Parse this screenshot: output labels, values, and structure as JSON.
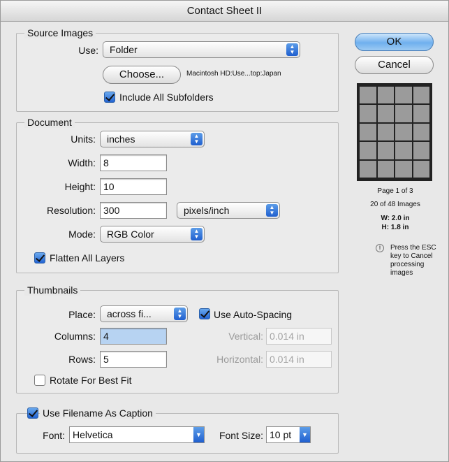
{
  "window": {
    "title": "Contact Sheet II"
  },
  "buttons": {
    "ok": "OK",
    "cancel": "Cancel"
  },
  "source": {
    "title": "Source Images",
    "use_label": "Use:",
    "use_value": "Folder",
    "choose_label": "Choose...",
    "path": "Macintosh HD:Use...top:Japan",
    "include_subfolders_label": "Include All Subfolders",
    "include_subfolders_checked": true
  },
  "document": {
    "title": "Document",
    "units_label": "Units:",
    "units_value": "inches",
    "width_label": "Width:",
    "width_value": "8",
    "height_label": "Height:",
    "height_value": "10",
    "resolution_label": "Resolution:",
    "resolution_value": "300",
    "resolution_units": "pixels/inch",
    "mode_label": "Mode:",
    "mode_value": "RGB Color",
    "flatten_label": "Flatten All Layers",
    "flatten_checked": true
  },
  "thumbnails": {
    "title": "Thumbnails",
    "place_label": "Place:",
    "place_value": "across fi...",
    "auto_spacing_label": "Use Auto-Spacing",
    "auto_spacing_checked": true,
    "columns_label": "Columns:",
    "columns_value": "4",
    "rows_label": "Rows:",
    "rows_value": "5",
    "vertical_label": "Vertical:",
    "vertical_value": "0.014 in",
    "horizontal_label": "Horizontal:",
    "horizontal_value": "0.014 in",
    "rotate_label": "Rotate For Best Fit",
    "rotate_checked": false
  },
  "caption": {
    "use_filename_label": "Use Filename As Caption",
    "use_filename_checked": true,
    "font_label": "Font:",
    "font_value": "Helvetica",
    "font_size_label": "Font Size:",
    "font_size_value": "10 pt"
  },
  "preview": {
    "page": "Page 1 of 3",
    "images": "20 of 48 Images",
    "w": "W: 2.0 in",
    "h": "H: 1.8 in",
    "note": "Press the ESC key to Cancel processing images",
    "columns": 4,
    "rows": 5
  },
  "colors": {
    "accent": "#2464d2",
    "window_bg": "#e8e8e8"
  },
  "icons": {
    "popup_arrows": "updown-arrows-icon",
    "warning": "info-circle-icon"
  }
}
